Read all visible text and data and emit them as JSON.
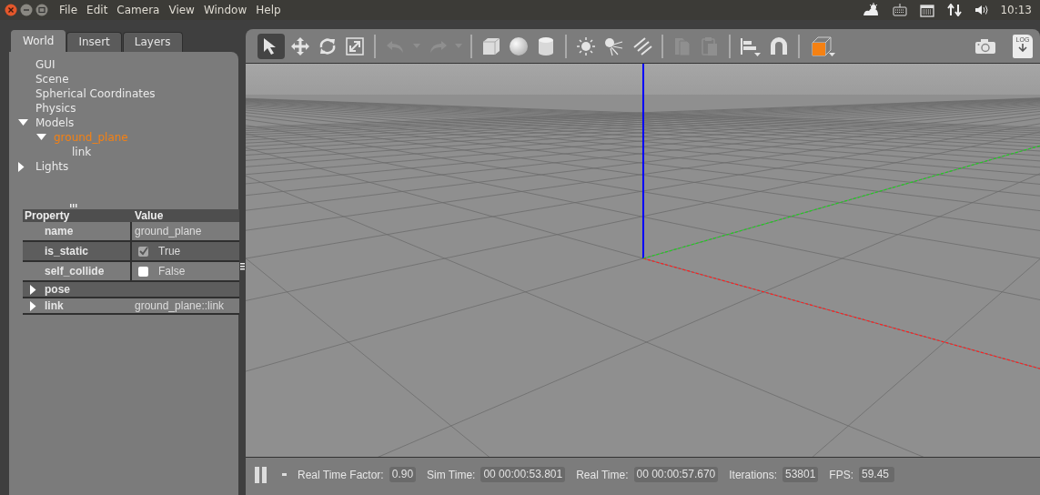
{
  "menu_bar": {
    "menus": [
      "File",
      "Edit",
      "Camera",
      "View",
      "Window",
      "Help"
    ],
    "clock": "10:13"
  },
  "tabs": [
    {
      "label": "World",
      "selected": true
    },
    {
      "label": "Insert",
      "selected": false
    },
    {
      "label": "Layers",
      "selected": false
    }
  ],
  "tree": [
    {
      "label": "GUI",
      "selected": false
    },
    {
      "label": "Scene",
      "selected": false
    },
    {
      "label": "Spherical Coordinates",
      "selected": false
    },
    {
      "label": "Physics",
      "selected": false
    },
    {
      "label": "Models",
      "selected": false,
      "expanded": true,
      "children": [
        {
          "label": "ground_plane",
          "selected": true,
          "expanded": true,
          "children": [
            {
              "label": "link",
              "selected": false
            }
          ]
        }
      ]
    },
    {
      "label": "Lights",
      "selected": false,
      "expanded": false
    }
  ],
  "properties": {
    "columns": [
      "Property",
      "Value"
    ],
    "rows": [
      {
        "kind": "text",
        "name": "name",
        "value": "ground_plane"
      },
      {
        "kind": "checkbox",
        "name": "is_static",
        "value": "True",
        "checked": true,
        "disabled": true
      },
      {
        "kind": "checkbox",
        "name": "self_collide",
        "value": "False",
        "checked": false,
        "disabled": false
      },
      {
        "kind": "group",
        "name": "pose",
        "expanded": false
      },
      {
        "kind": "group",
        "name": "link",
        "value": "ground_plane::link",
        "expanded": false
      }
    ]
  },
  "toolbar": {
    "groups": [
      [
        {
          "kind": "select",
          "selected": true,
          "disabled": false
        },
        {
          "kind": "translate",
          "selected": false,
          "disabled": false
        },
        {
          "kind": "rotate",
          "selected": false,
          "disabled": false
        },
        {
          "kind": "scale",
          "selected": false,
          "disabled": false
        }
      ],
      [
        {
          "kind": "undo",
          "selected": false,
          "disabled": true
        },
        {
          "kind": "dropdown",
          "selected": false,
          "disabled": true
        },
        {
          "kind": "redo",
          "selected": false,
          "disabled": true
        },
        {
          "kind": "dropdown",
          "selected": false,
          "disabled": true
        }
      ],
      [
        {
          "kind": "box",
          "selected": false,
          "disabled": false
        },
        {
          "kind": "sphere",
          "selected": false,
          "disabled": false
        },
        {
          "kind": "cylinder",
          "selected": false,
          "disabled": false
        }
      ],
      [
        {
          "kind": "point-light",
          "selected": false,
          "disabled": false
        },
        {
          "kind": "spot-light",
          "selected": false,
          "disabled": false
        },
        {
          "kind": "directional-light",
          "selected": false,
          "disabled": false
        }
      ],
      [
        {
          "kind": "copy",
          "selected": false,
          "disabled": true
        },
        {
          "kind": "paste",
          "selected": false,
          "disabled": true
        }
      ],
      [
        {
          "kind": "align",
          "selected": false,
          "disabled": false
        },
        {
          "kind": "magnet",
          "selected": false,
          "disabled": false
        }
      ],
      [
        {
          "kind": "view-angle",
          "selected": false,
          "disabled": false
        }
      ]
    ],
    "right_tools": [
      {
        "kind": "screenshot",
        "disabled": false
      },
      {
        "kind": "log",
        "label": "LOG",
        "disabled": false
      }
    ]
  },
  "status_bar": {
    "paused": true,
    "fields": [
      {
        "label": "Real Time Factor:",
        "value": "0.90"
      },
      {
        "label": "Sim Time:",
        "value": "00 00:00:53.801"
      },
      {
        "label": "Real Time:",
        "value": "00 00:00:57.670"
      },
      {
        "label": "Iterations:",
        "value": "53801"
      },
      {
        "label": "FPS:",
        "value": "59.45"
      }
    ]
  }
}
